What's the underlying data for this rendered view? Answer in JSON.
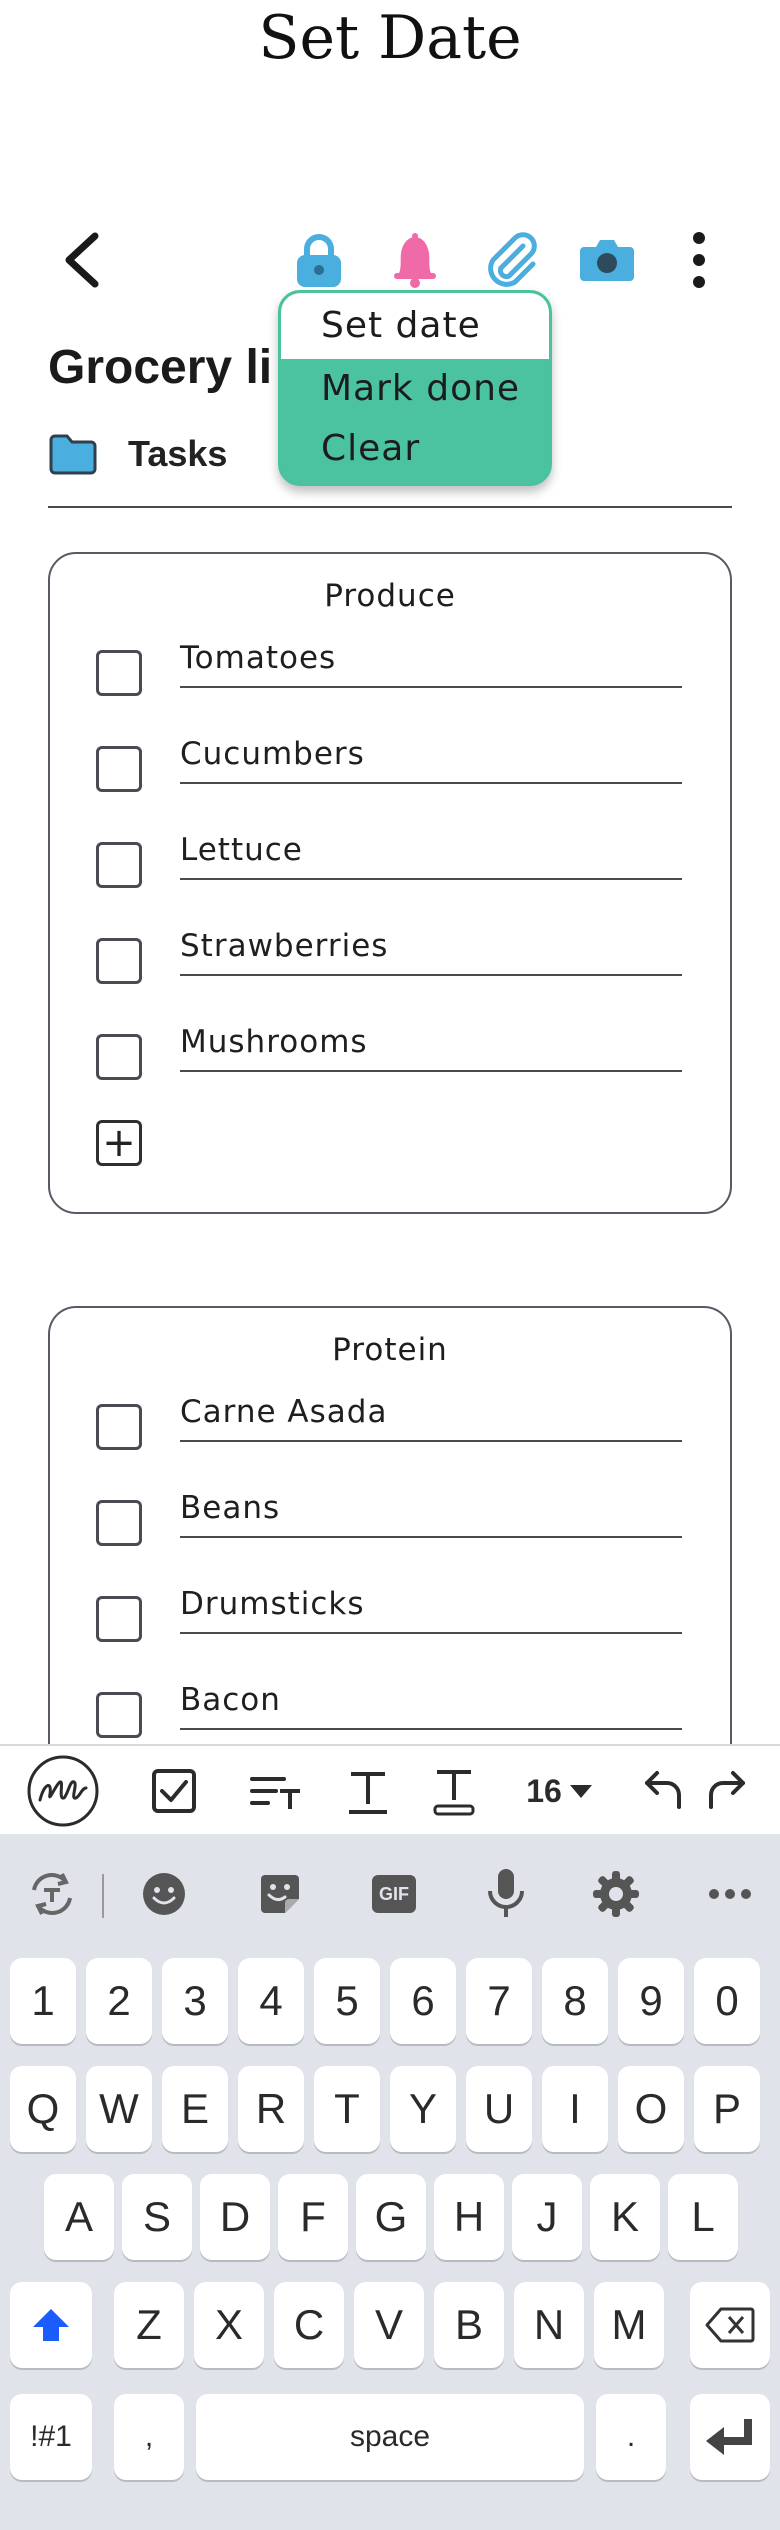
{
  "app": {
    "title": "Set Date"
  },
  "header": {
    "icons": [
      "back-arrow-icon",
      "lock-icon",
      "bell-icon",
      "paperclip-icon",
      "camera-icon",
      "more-vertical-icon"
    ]
  },
  "dropdown_menu": {
    "items": [
      "Set date",
      "Mark done",
      "Clear"
    ],
    "selected": "Set date"
  },
  "note": {
    "title": "Grocery li",
    "folder": "Tasks"
  },
  "sections": [
    {
      "title": "Produce",
      "items": [
        "Tomatoes",
        "Cucumbers",
        "Lettuce",
        "Strawberries",
        "Mushrooms"
      ],
      "add_label": "+"
    },
    {
      "title": "Protein",
      "items": [
        "Carne Asada",
        "Beans",
        "Drumsticks",
        "Bacon"
      ]
    }
  ],
  "format_bar": {
    "font_size": "16",
    "icons": [
      "handwriting-icon",
      "checkbox-icon",
      "text-style-icon",
      "text-format-icon",
      "text-highlight-icon",
      "font-size-dropdown",
      "undo-icon",
      "redo-icon"
    ]
  },
  "keyboard": {
    "toolbar_icons": [
      "translate-icon",
      "emoji-icon",
      "sticker-icon",
      "gif-icon",
      "microphone-icon",
      "settings-icon",
      "more-icon"
    ],
    "gif_label": "GIF",
    "row_numbers": [
      "1",
      "2",
      "3",
      "4",
      "5",
      "6",
      "7",
      "8",
      "9",
      "0"
    ],
    "row_1": [
      "Q",
      "W",
      "E",
      "R",
      "T",
      "Y",
      "U",
      "I",
      "O",
      "P"
    ],
    "row_2": [
      "A",
      "S",
      "D",
      "F",
      "G",
      "H",
      "J",
      "K",
      "L"
    ],
    "row_3": [
      "Z",
      "X",
      "C",
      "V",
      "B",
      "N",
      "M"
    ],
    "symbols_label": "!#1",
    "comma_label": ",",
    "space_label": "space",
    "period_label": ".",
    "colors": {
      "accent": "#4cc3a0",
      "icon_blue": "#4aaede",
      "bell_pink": "#ef6aa6",
      "shift_blue": "#1b5cff"
    }
  }
}
